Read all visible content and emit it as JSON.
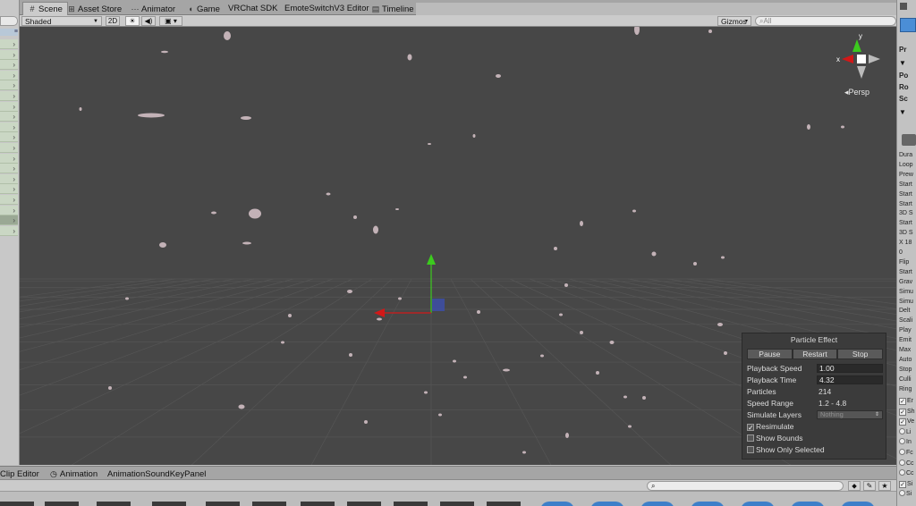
{
  "tabs": [
    {
      "label": "Scene",
      "icon": "grid-icon",
      "active": true
    },
    {
      "label": "Asset Store",
      "icon": "cart-icon"
    },
    {
      "label": "Animator",
      "icon": "animator-icon"
    },
    {
      "label": "Game",
      "icon": "pacman-icon"
    },
    {
      "label": "VRChat SDK",
      "icon": ""
    },
    {
      "label": "EmoteSwitchV3 Editor",
      "icon": ""
    },
    {
      "label": "Timeline",
      "icon": "timeline-icon"
    }
  ],
  "scene_toolbar": {
    "shading_mode": "Shaded",
    "mode_2d": "2D",
    "gizmos_label": "Gizmos",
    "search_placeholder": "All"
  },
  "gizmo": {
    "x_label": "x",
    "y_label": "y",
    "projection_label": "Persp"
  },
  "particle_effect": {
    "title": "Particle Effect",
    "buttons": {
      "pause": "Pause",
      "restart": "Restart",
      "stop": "Stop"
    },
    "playback_speed_label": "Playback Speed",
    "playback_speed": "1.00",
    "playback_time_label": "Playback Time",
    "playback_time": "4.32",
    "particles_label": "Particles",
    "particles": "214",
    "speed_range_label": "Speed Range",
    "speed_range": "1.2 - 4.8",
    "simulate_layers_label": "Simulate Layers",
    "simulate_layers": "Nothing",
    "resimulate_label": "Resimulate",
    "resimulate_checked": true,
    "show_bounds_label": "Show Bounds",
    "show_bounds_checked": false,
    "show_only_selected_label": "Show Only Selected",
    "show_only_selected_checked": false
  },
  "inspector": {
    "header_items": [
      "Pr",
      "Po",
      "Ro",
      "Sc"
    ],
    "properties": [
      "Dura",
      "Loop",
      "Prew",
      "Start",
      "Start",
      "Start",
      "3D S",
      "Start",
      "3D S",
      "X 18",
      "0",
      "Flip",
      "Start",
      "Grav",
      "Simu",
      "Simu",
      "Delt",
      "Scali",
      "Play",
      "Emit",
      "Max",
      "Auto",
      "Stop",
      "Culli",
      "Ring"
    ],
    "modules": [
      "Er",
      "Sh",
      "Ve",
      "Li",
      "In",
      "Fc",
      "Cc",
      "Cc",
      "Si",
      "Si"
    ]
  },
  "bottom_tabs": [
    {
      "label": "Clip Editor",
      "icon": ""
    },
    {
      "label": "Animation",
      "icon": "clock-icon"
    },
    {
      "label": "AnimationSoundKeyPanel",
      "icon": ""
    }
  ],
  "colors": {
    "viewport_bg": "#474747",
    "particle": "#d9c6cb",
    "axis_x": "#d21818",
    "axis_y": "#3ccb1e",
    "axis_z": "#3d4fa8",
    "panel_bg": "#3b3b3b"
  }
}
